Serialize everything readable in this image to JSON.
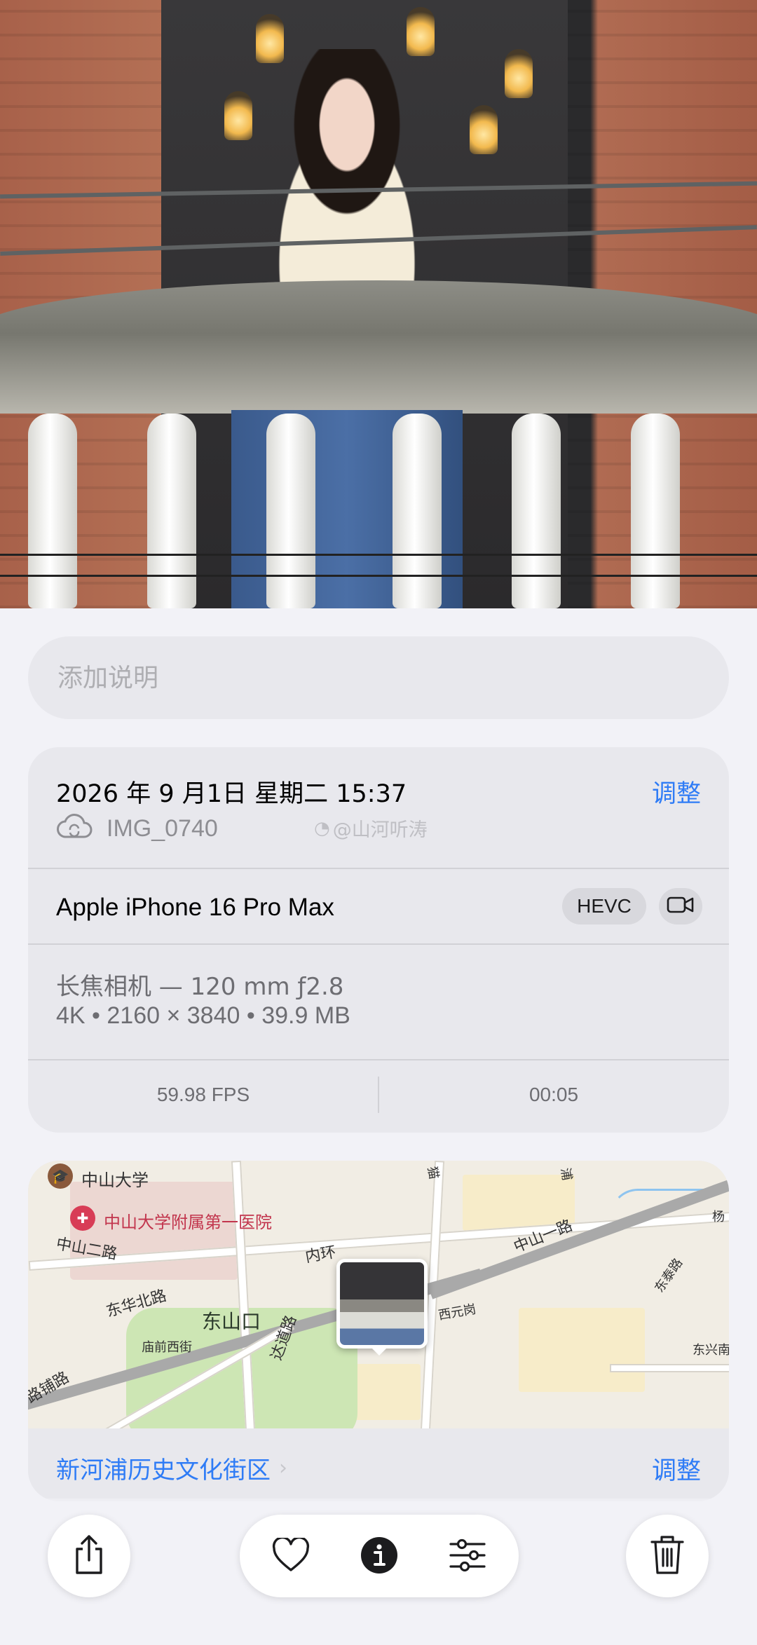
{
  "caption": {
    "placeholder": "添加说明"
  },
  "info": {
    "datetime": "2026 年 9 月1日 星期二 15:37",
    "adjust_label": "调整",
    "filename": "IMG_0740",
    "watermark": "@山河听涛",
    "device": "Apple iPhone 16 Pro Max",
    "codec_badge": "HEVC",
    "lens": "长焦相机 — 120 mm ƒ2.8",
    "specs": "4K • 2160 × 3840 • 39.9 MB",
    "fps": "59.98 FPS",
    "duration": "00:05"
  },
  "map": {
    "labels": {
      "zsdx": "中山大学",
      "hospital": "中山大学附属第一医院",
      "zs2": "中山二路",
      "zs1": "中山一路",
      "dongshankou": "东山口",
      "dongshan_north": "东华北路",
      "neihuan": "内环",
      "temple": "庙前西街",
      "dadao": "达道路",
      "xiyuan": "西元岗",
      "dongtai": "东泰路",
      "dongxing": "东兴南",
      "yang": "杨",
      "pu": "路铺路",
      "xiang": "浦",
      "mao": "猫"
    },
    "location_name": "新河浦历史文化街区",
    "adjust_label": "调整"
  },
  "icons": {
    "share": "share-icon",
    "favorite": "heart-icon",
    "info": "info-icon",
    "adjust": "sliders-icon",
    "delete": "trash-icon"
  },
  "colors": {
    "accent": "#2f7cf6",
    "card": "#e8e8ed",
    "background": "#f2f2f7"
  }
}
